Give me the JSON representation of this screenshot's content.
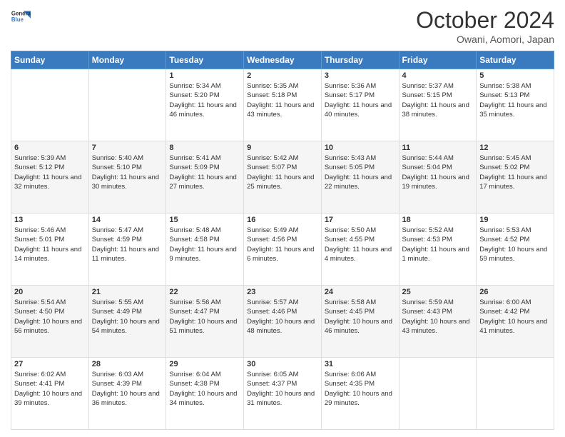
{
  "header": {
    "logo_line1": "General",
    "logo_line2": "Blue",
    "month": "October 2024",
    "location": "Owani, Aomori, Japan"
  },
  "weekdays": [
    "Sunday",
    "Monday",
    "Tuesday",
    "Wednesday",
    "Thursday",
    "Friday",
    "Saturday"
  ],
  "weeks": [
    [
      null,
      null,
      {
        "day": "1",
        "sunrise": "5:34 AM",
        "sunset": "5:20 PM",
        "daylight": "11 hours and 46 minutes."
      },
      {
        "day": "2",
        "sunrise": "5:35 AM",
        "sunset": "5:18 PM",
        "daylight": "11 hours and 43 minutes."
      },
      {
        "day": "3",
        "sunrise": "5:36 AM",
        "sunset": "5:17 PM",
        "daylight": "11 hours and 40 minutes."
      },
      {
        "day": "4",
        "sunrise": "5:37 AM",
        "sunset": "5:15 PM",
        "daylight": "11 hours and 38 minutes."
      },
      {
        "day": "5",
        "sunrise": "5:38 AM",
        "sunset": "5:13 PM",
        "daylight": "11 hours and 35 minutes."
      }
    ],
    [
      {
        "day": "6",
        "sunrise": "5:39 AM",
        "sunset": "5:12 PM",
        "daylight": "11 hours and 32 minutes."
      },
      {
        "day": "7",
        "sunrise": "5:40 AM",
        "sunset": "5:10 PM",
        "daylight": "11 hours and 30 minutes."
      },
      {
        "day": "8",
        "sunrise": "5:41 AM",
        "sunset": "5:09 PM",
        "daylight": "11 hours and 27 minutes."
      },
      {
        "day": "9",
        "sunrise": "5:42 AM",
        "sunset": "5:07 PM",
        "daylight": "11 hours and 25 minutes."
      },
      {
        "day": "10",
        "sunrise": "5:43 AM",
        "sunset": "5:05 PM",
        "daylight": "11 hours and 22 minutes."
      },
      {
        "day": "11",
        "sunrise": "5:44 AM",
        "sunset": "5:04 PM",
        "daylight": "11 hours and 19 minutes."
      },
      {
        "day": "12",
        "sunrise": "5:45 AM",
        "sunset": "5:02 PM",
        "daylight": "11 hours and 17 minutes."
      }
    ],
    [
      {
        "day": "13",
        "sunrise": "5:46 AM",
        "sunset": "5:01 PM",
        "daylight": "11 hours and 14 minutes."
      },
      {
        "day": "14",
        "sunrise": "5:47 AM",
        "sunset": "4:59 PM",
        "daylight": "11 hours and 11 minutes."
      },
      {
        "day": "15",
        "sunrise": "5:48 AM",
        "sunset": "4:58 PM",
        "daylight": "11 hours and 9 minutes."
      },
      {
        "day": "16",
        "sunrise": "5:49 AM",
        "sunset": "4:56 PM",
        "daylight": "11 hours and 6 minutes."
      },
      {
        "day": "17",
        "sunrise": "5:50 AM",
        "sunset": "4:55 PM",
        "daylight": "11 hours and 4 minutes."
      },
      {
        "day": "18",
        "sunrise": "5:52 AM",
        "sunset": "4:53 PM",
        "daylight": "11 hours and 1 minute."
      },
      {
        "day": "19",
        "sunrise": "5:53 AM",
        "sunset": "4:52 PM",
        "daylight": "10 hours and 59 minutes."
      }
    ],
    [
      {
        "day": "20",
        "sunrise": "5:54 AM",
        "sunset": "4:50 PM",
        "daylight": "10 hours and 56 minutes."
      },
      {
        "day": "21",
        "sunrise": "5:55 AM",
        "sunset": "4:49 PM",
        "daylight": "10 hours and 54 minutes."
      },
      {
        "day": "22",
        "sunrise": "5:56 AM",
        "sunset": "4:47 PM",
        "daylight": "10 hours and 51 minutes."
      },
      {
        "day": "23",
        "sunrise": "5:57 AM",
        "sunset": "4:46 PM",
        "daylight": "10 hours and 48 minutes."
      },
      {
        "day": "24",
        "sunrise": "5:58 AM",
        "sunset": "4:45 PM",
        "daylight": "10 hours and 46 minutes."
      },
      {
        "day": "25",
        "sunrise": "5:59 AM",
        "sunset": "4:43 PM",
        "daylight": "10 hours and 43 minutes."
      },
      {
        "day": "26",
        "sunrise": "6:00 AM",
        "sunset": "4:42 PM",
        "daylight": "10 hours and 41 minutes."
      }
    ],
    [
      {
        "day": "27",
        "sunrise": "6:02 AM",
        "sunset": "4:41 PM",
        "daylight": "10 hours and 39 minutes."
      },
      {
        "day": "28",
        "sunrise": "6:03 AM",
        "sunset": "4:39 PM",
        "daylight": "10 hours and 36 minutes."
      },
      {
        "day": "29",
        "sunrise": "6:04 AM",
        "sunset": "4:38 PM",
        "daylight": "10 hours and 34 minutes."
      },
      {
        "day": "30",
        "sunrise": "6:05 AM",
        "sunset": "4:37 PM",
        "daylight": "10 hours and 31 minutes."
      },
      {
        "day": "31",
        "sunrise": "6:06 AM",
        "sunset": "4:35 PM",
        "daylight": "10 hours and 29 minutes."
      },
      null,
      null
    ]
  ],
  "labels": {
    "sunrise_prefix": "Sunrise: ",
    "sunset_prefix": "Sunset: ",
    "daylight_prefix": "Daylight: "
  }
}
